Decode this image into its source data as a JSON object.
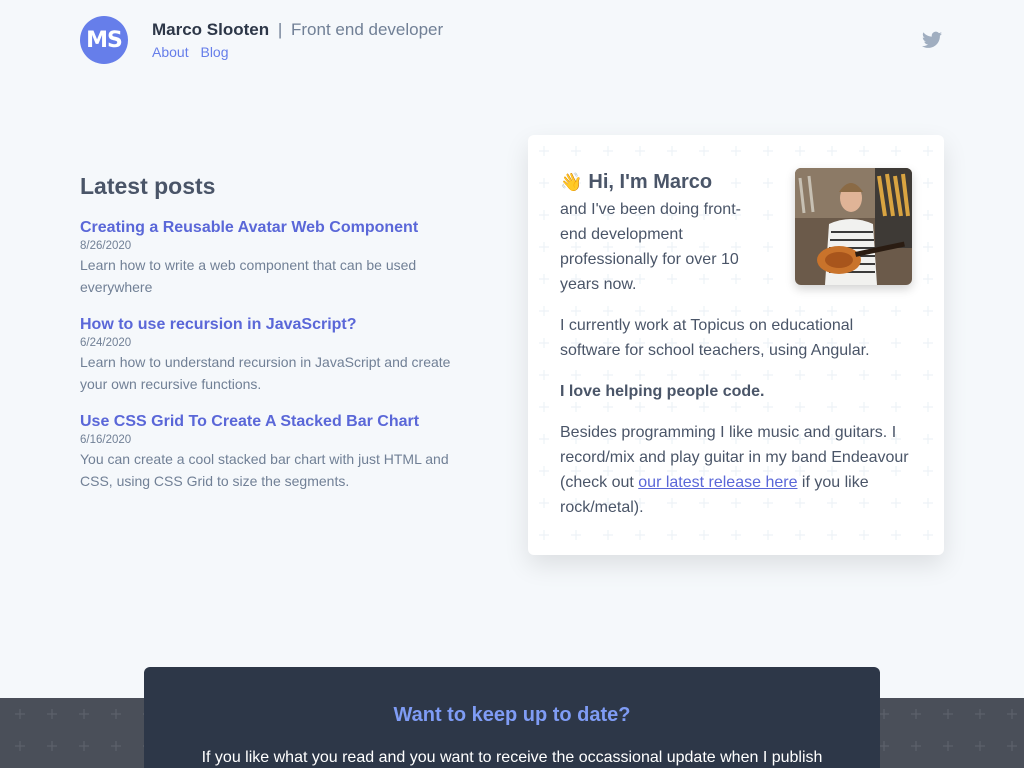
{
  "header": {
    "logo_text": "MS",
    "name": "Marco Slooten",
    "separator": "|",
    "role": "Front end developer",
    "nav": [
      {
        "label": "About"
      },
      {
        "label": "Blog"
      }
    ],
    "social_icon": "twitter-icon"
  },
  "posts": {
    "heading": "Latest posts",
    "items": [
      {
        "title": "Creating a Reusable Avatar Web Component",
        "date": "8/26/2020",
        "description": "Learn how to write a web component that can be used everywhere"
      },
      {
        "title": "How to use recursion in JavaScript?",
        "date": "6/24/2020",
        "description": "Learn how to understand recursion in JavaScript and create your own recursive functions."
      },
      {
        "title": "Use CSS Grid To Create A Stacked Bar Chart",
        "date": "6/16/2020",
        "description": "You can create a cool stacked bar chart with just HTML and CSS, using CSS Grid to size the segments."
      }
    ]
  },
  "about": {
    "wave": "👋",
    "greeting": "Hi, I'm Marco",
    "intro": "and I've been doing front-end development professionally for over 10 years now.",
    "work": "I currently work at Topicus on educational software for school teachers, using Angular.",
    "love": "I love helping people code.",
    "music_before": "Besides programming I like music and guitars. I record/mix and play guitar in my band Endeavour (check out ",
    "music_link": "our latest release here",
    "music_after": " if you like rock/metal)."
  },
  "newsletter": {
    "title": "Want to keep up to date?",
    "text": "If you like what you read and you want to receive the occassional update when I publish"
  },
  "colors": {
    "accent": "#667eea",
    "link": "#5a67d8",
    "footer": "#2d3748",
    "background": "#f5f8fb"
  }
}
